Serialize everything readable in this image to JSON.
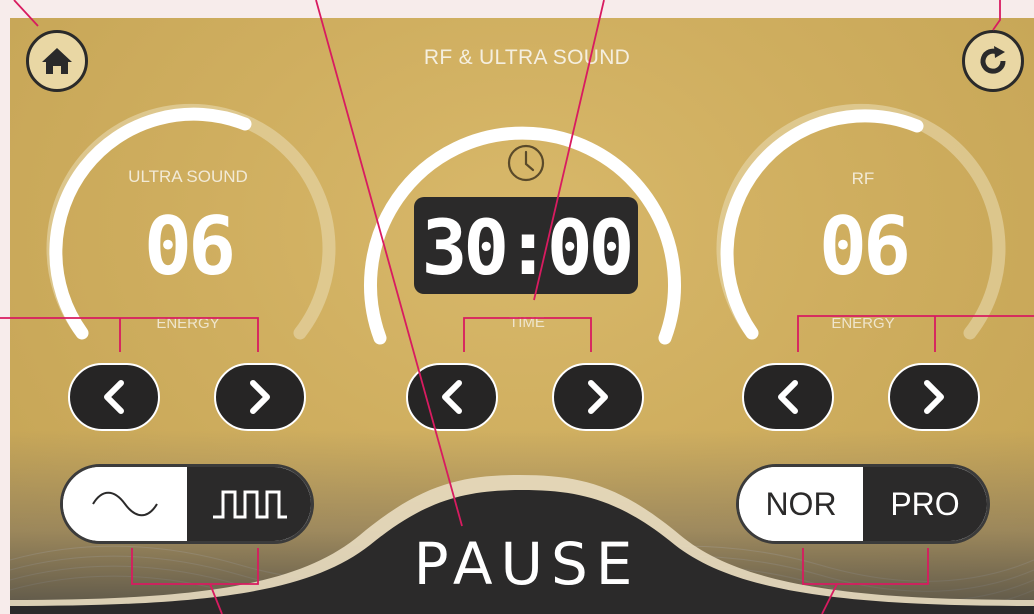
{
  "header": {
    "title": "RF & ULTRA SOUND",
    "home_icon": "home-icon",
    "refresh_icon": "refresh-icon"
  },
  "dials": [
    {
      "label": "ULTRA SOUND",
      "value": "06",
      "control_label": "ENERGY"
    },
    {
      "label": "",
      "value": "30:00",
      "control_label": "TIME",
      "icon": "clock-icon"
    },
    {
      "label": "RF",
      "value": "06",
      "control_label": "ENERGY"
    }
  ],
  "waveform_toggle": {
    "options": [
      "sine-wave-icon",
      "square-wave-icon"
    ],
    "selected": "square-wave-icon"
  },
  "mode_toggle": {
    "options": [
      "NOR",
      "PRO"
    ],
    "selected": "PRO"
  },
  "pause_button": {
    "label": "PAUSE"
  },
  "colors": {
    "panel": "#cfae5f",
    "dark": "#2b2a2a",
    "annotation": "#d81b60"
  }
}
